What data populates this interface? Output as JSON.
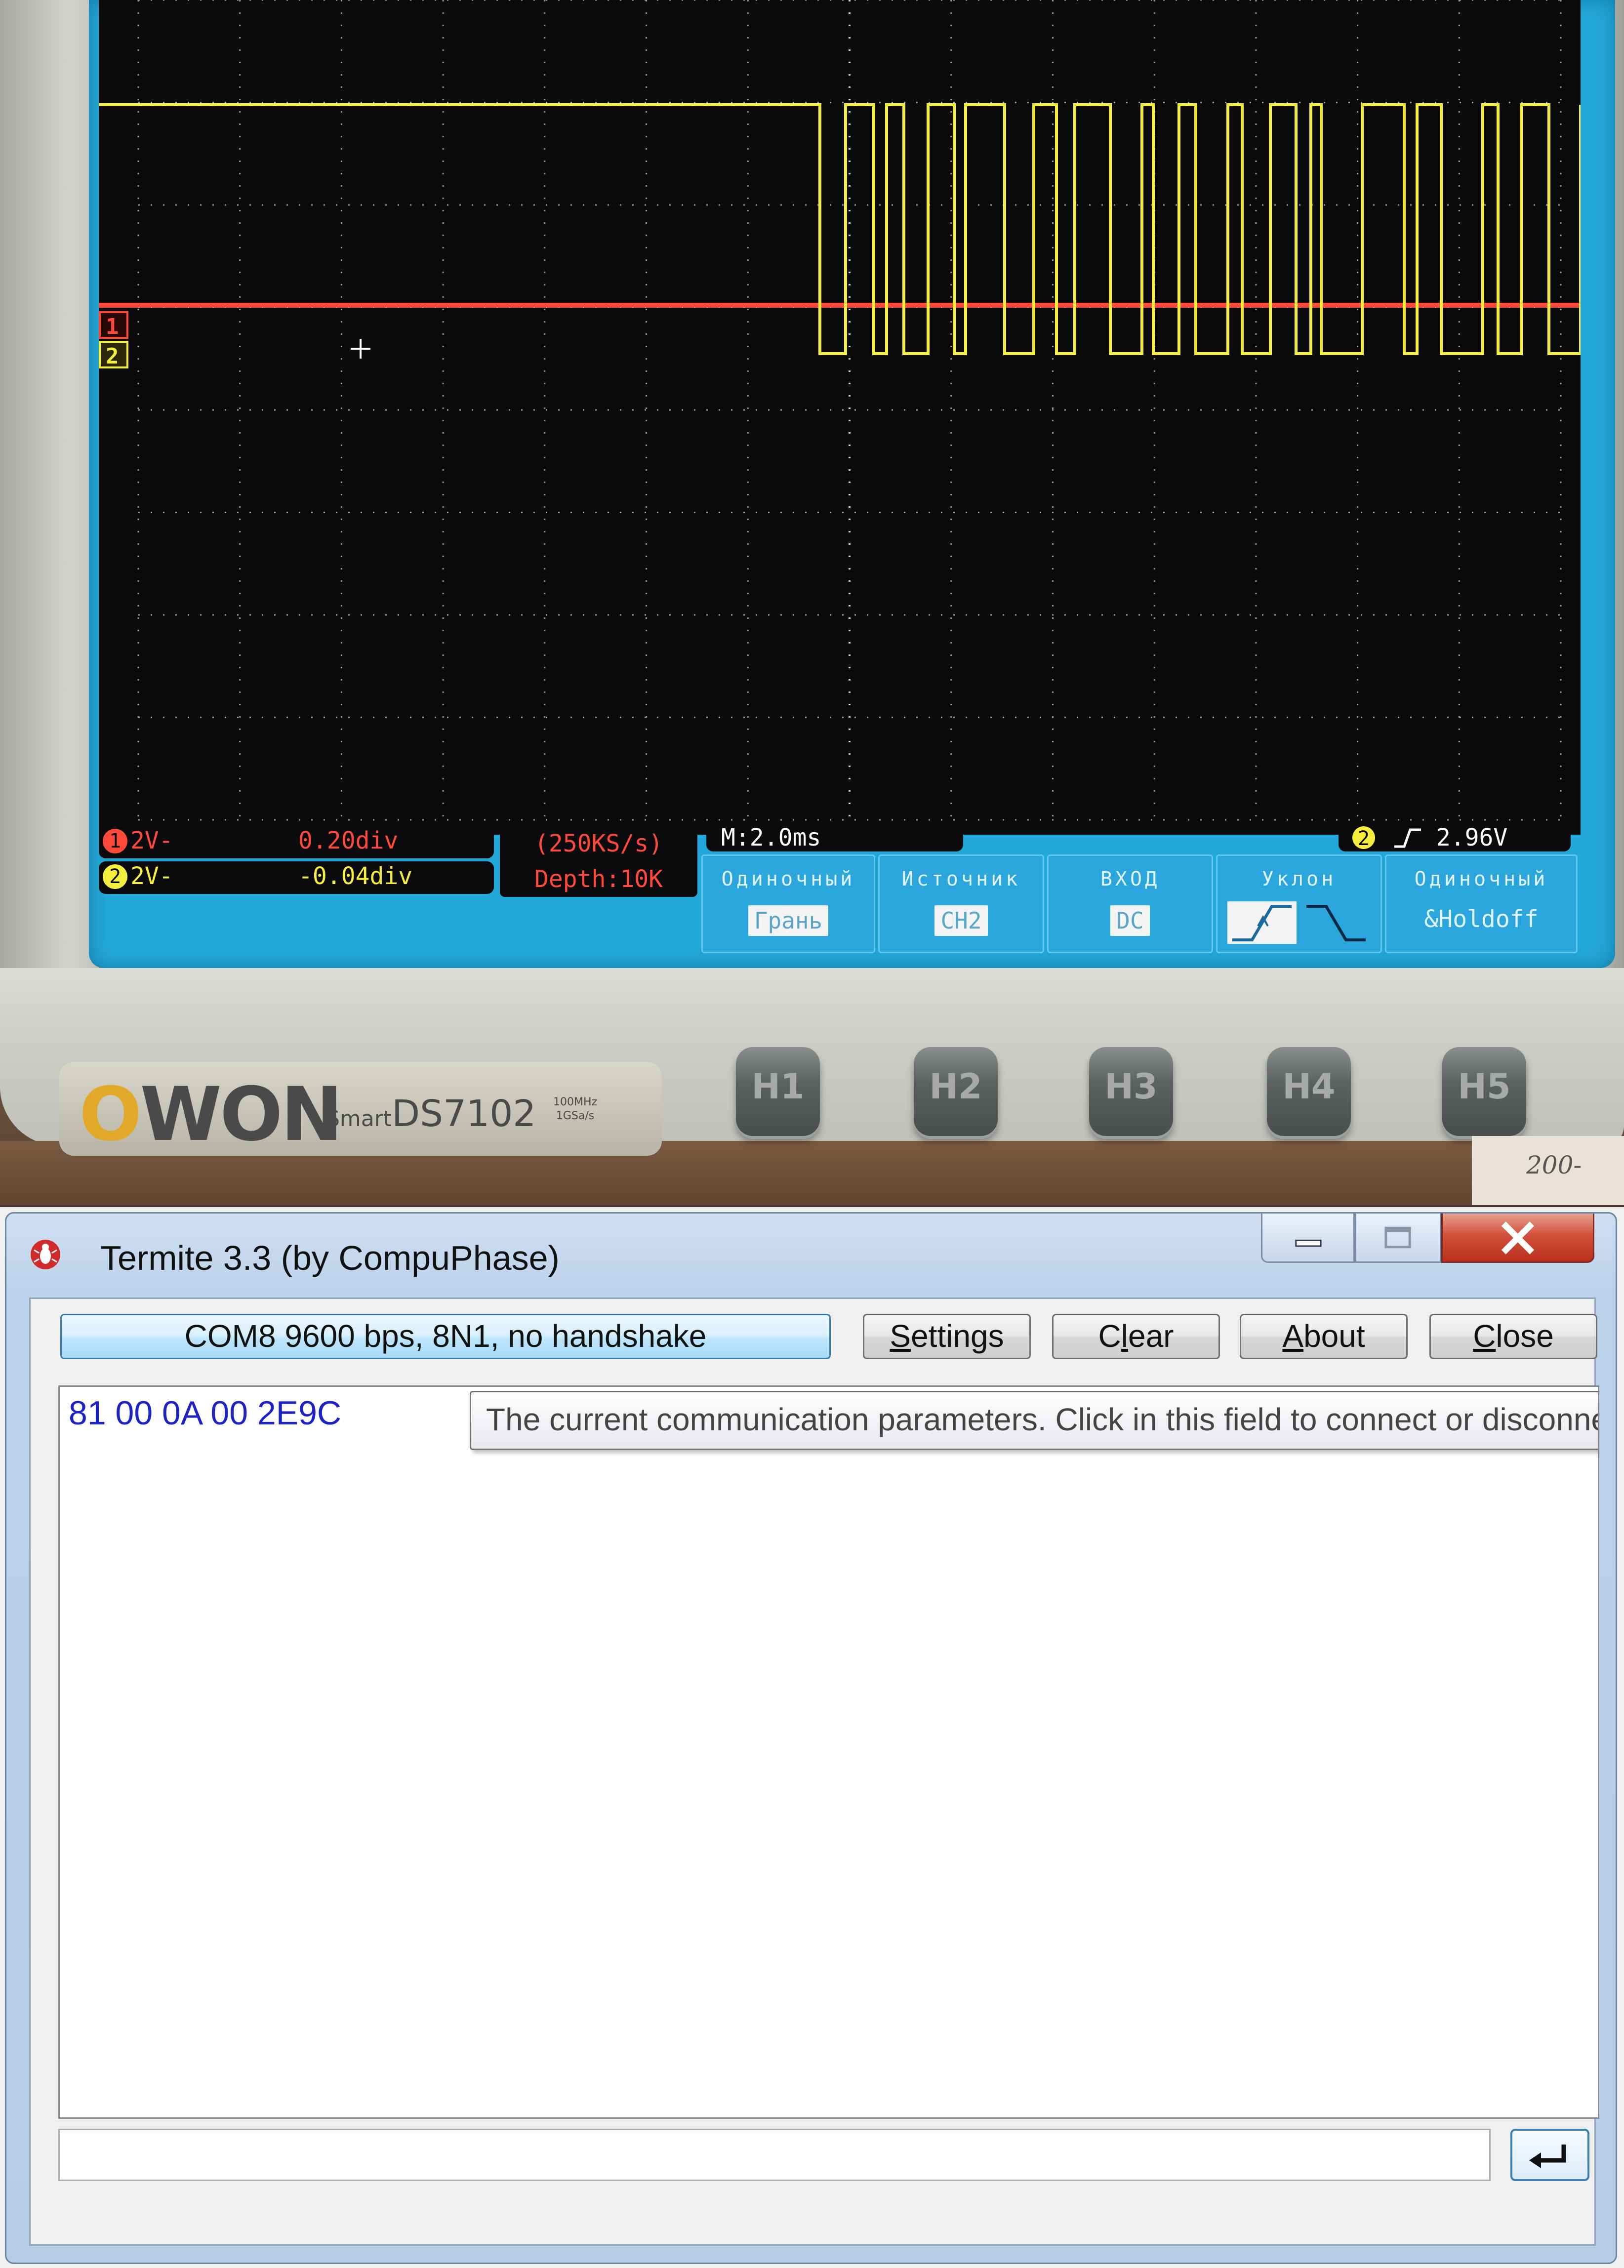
{
  "oscilloscope": {
    "brand": "OWON",
    "model_prefix": "Smart",
    "model": "DS7102",
    "spec_bandwidth": "100MHz",
    "spec_rate": "1GSa/s",
    "ch1_marker": "1",
    "ch2_marker": "2",
    "ch1_scale": "2V-",
    "ch1_offset": "0.20div",
    "ch2_scale": "2V-",
    "ch2_offset": "-0.04div",
    "ch1_dot": "1",
    "ch2_dot": "2",
    "sample_rate": "(250KS/s)",
    "depth": "Depth:10K",
    "timebase": "M:2.0ms",
    "trigger_channel": "2",
    "trigger_level": "2.96V",
    "menu": [
      {
        "title": "Одиночный",
        "value": "Грань"
      },
      {
        "title": "Источник",
        "value": "CH2"
      },
      {
        "title": "ВХОД",
        "value": "DC"
      },
      {
        "title": "Уклон",
        "value": ""
      },
      {
        "title": "Одиночный",
        "value": "&Holdoff"
      }
    ],
    "buttons": [
      "H1",
      "H2",
      "H3",
      "H4",
      "H5"
    ],
    "paper_note": "200-",
    "colors": {
      "ch1": "#ff4a3a",
      "ch2": "#f5ee3c",
      "frame": "#22a8d8"
    }
  },
  "termite": {
    "title": "Termite 3.3 (by CompuPhase)",
    "comm_button": "COM8 9600 bps, 8N1, no handshake",
    "settings": {
      "pre": "",
      "u": "S",
      "post": "ettings"
    },
    "clear": {
      "pre": "C",
      "u": "l",
      "post": "ear"
    },
    "about": {
      "pre": "",
      "u": "A",
      "post": "bout"
    },
    "close": {
      "pre": "",
      "u": "C",
      "post": "lose"
    },
    "output_line": "81 00 0A 00 2E9C",
    "tooltip": "The current communication parameters. Click in this field to connect or disconnect.",
    "input_value": "",
    "colors": {
      "output_text": "#1a22c8",
      "close_button": "#c8391f"
    }
  }
}
